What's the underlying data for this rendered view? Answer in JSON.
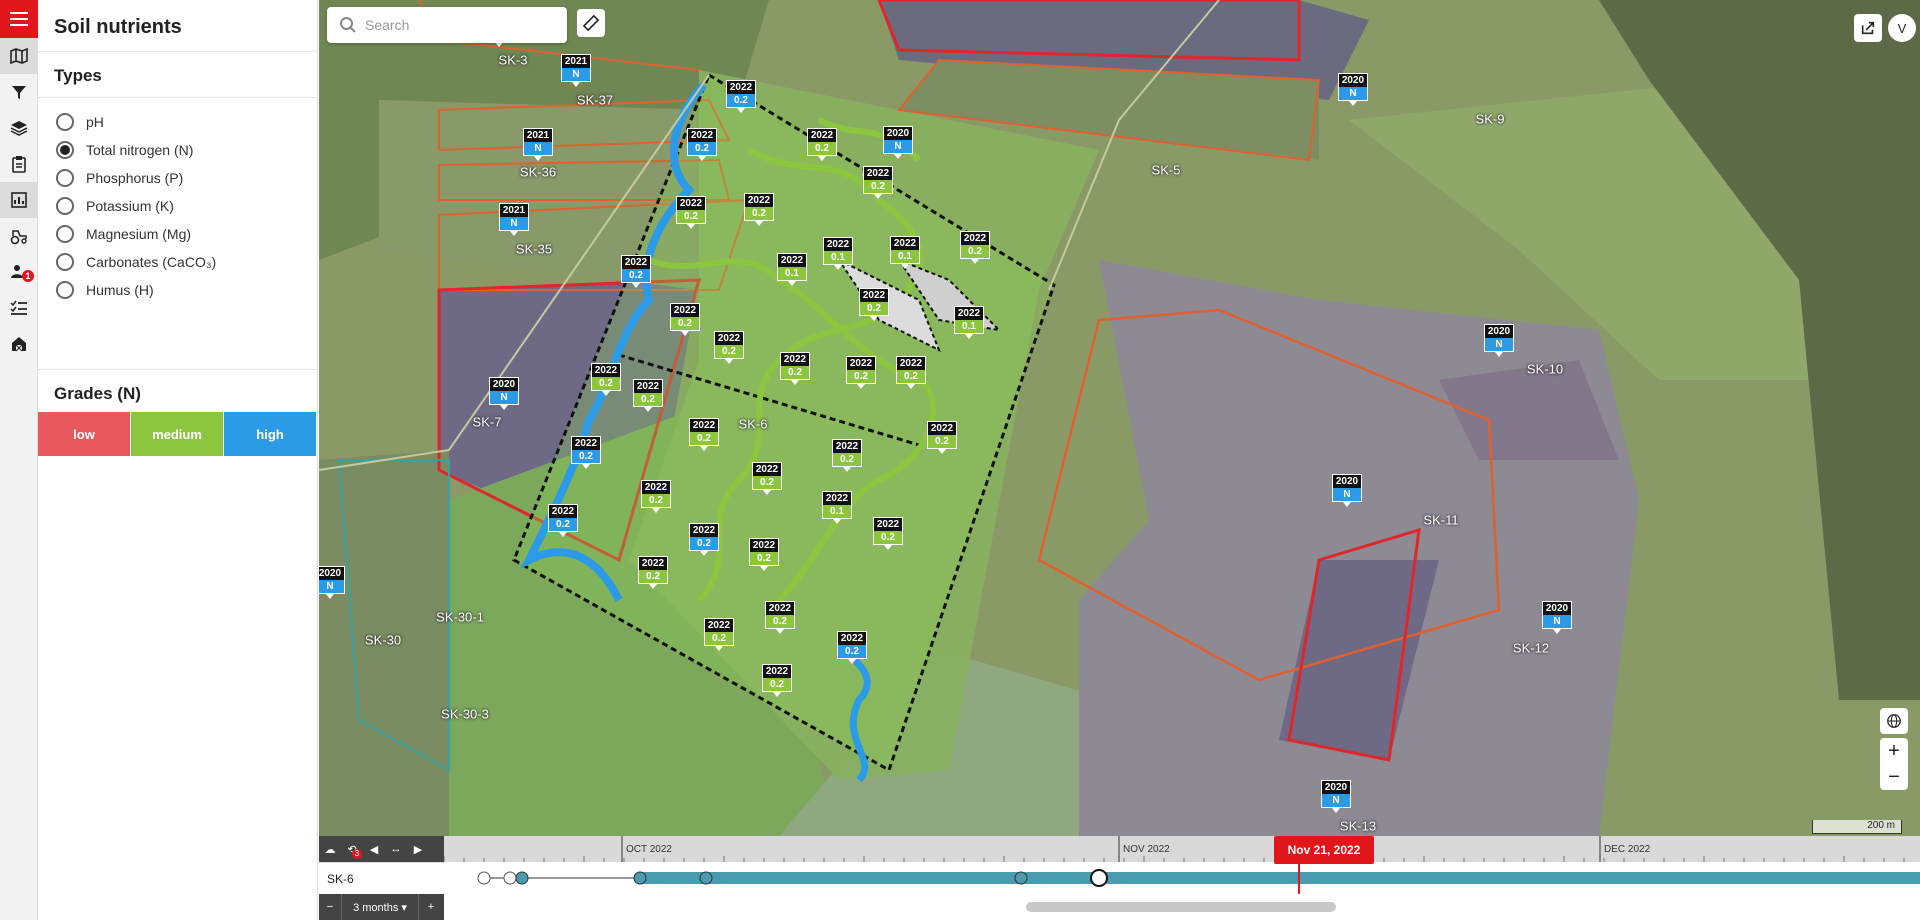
{
  "panel": {
    "title": "Soil nutrients",
    "types_heading": "Types",
    "types": [
      {
        "label": "pH",
        "selected": false
      },
      {
        "label": "Total nitrogen (N)",
        "selected": true
      },
      {
        "label": "Phosphorus (P)",
        "selected": false
      },
      {
        "label": "Potassium (K)",
        "selected": false
      },
      {
        "label": "Magnesium (Mg)",
        "selected": false
      },
      {
        "label": "Carbonates (CaCO₃)",
        "selected": false
      },
      {
        "label": "Humus (H)",
        "selected": false
      }
    ],
    "grades_heading": "Grades (N)",
    "grades": [
      {
        "label": "low",
        "color": "#e8595d"
      },
      {
        "label": "medium",
        "color": "#8cc63f"
      },
      {
        "label": "high",
        "color": "#2b9be8"
      }
    ]
  },
  "rail": {
    "notification_count": "1",
    "icons": [
      "map-icon",
      "filter-icon",
      "layers-icon",
      "clipboard-icon",
      "chart-icon",
      "tractor-icon",
      "users-icon",
      "list-icon",
      "barn-icon"
    ]
  },
  "map": {
    "search_placeholder": "Search",
    "account_initial": "V",
    "scale_label": "200 m",
    "zoom_in": "+",
    "zoom_out": "−",
    "field_labels": [
      "SK-3",
      "SK-37",
      "SK-36",
      "SK-35",
      "SK-7",
      "SK-6",
      "SK-5",
      "SK-9",
      "SK-10",
      "SK-11",
      "SK-12",
      "SK-13",
      "SK-30",
      "SK-30-1",
      "SK-30-3"
    ],
    "samples_2022": [
      {
        "year": "2022",
        "value": "0.2",
        "grade": "high"
      },
      {
        "year": "2022",
        "value": "0.2",
        "grade": "medium"
      },
      {
        "year": "2022",
        "value": "0.2",
        "grade": "medium"
      },
      {
        "year": "2022",
        "value": "0.2",
        "grade": "medium"
      },
      {
        "year": "2022",
        "value": "0.2",
        "grade": "medium"
      },
      {
        "year": "2022",
        "value": "0.1",
        "grade": "medium"
      },
      {
        "year": "2022",
        "value": "0.1",
        "grade": "medium"
      },
      {
        "year": "2022",
        "value": "0.1",
        "grade": "medium"
      }
    ],
    "legacy_markers": [
      {
        "year": "2020",
        "value": "N"
      },
      {
        "year": "2021",
        "value": "N"
      }
    ]
  },
  "timeline": {
    "months": [
      "OCT 2022",
      "NOV 2022",
      "DEC 2022"
    ],
    "current_date": "Nov 21, 2022",
    "field": "SK-6",
    "range": "3 months ▾",
    "minus": "−",
    "plus": "+",
    "badge": "3"
  }
}
